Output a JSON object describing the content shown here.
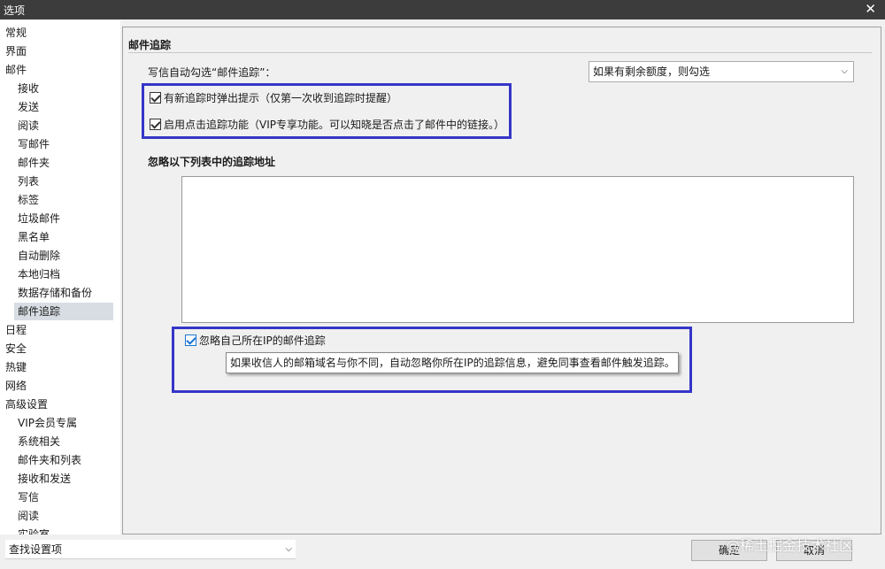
{
  "window": {
    "title": "选项",
    "close_symbol": "✕"
  },
  "sidebar": {
    "items": [
      {
        "label": "常规",
        "level": 0
      },
      {
        "label": "界面",
        "level": 0
      },
      {
        "label": "邮件",
        "level": 0
      },
      {
        "label": "接收",
        "level": 1
      },
      {
        "label": "发送",
        "level": 1
      },
      {
        "label": "阅读",
        "level": 1
      },
      {
        "label": "写邮件",
        "level": 1
      },
      {
        "label": "邮件夹",
        "level": 1
      },
      {
        "label": "列表",
        "level": 1
      },
      {
        "label": "标签",
        "level": 1
      },
      {
        "label": "垃圾邮件",
        "level": 1
      },
      {
        "label": "黑名单",
        "level": 1
      },
      {
        "label": "自动删除",
        "level": 1
      },
      {
        "label": "本地归档",
        "level": 1
      },
      {
        "label": "数据存储和备份",
        "level": 1
      },
      {
        "label": "邮件追踪",
        "level": 1,
        "selected": true
      },
      {
        "label": "日程",
        "level": 0
      },
      {
        "label": "安全",
        "level": 0
      },
      {
        "label": "热键",
        "level": 0
      },
      {
        "label": "网络",
        "level": 0
      },
      {
        "label": "高级设置",
        "level": 0
      },
      {
        "label": "VIP会员专属",
        "level": 1
      },
      {
        "label": "系统相关",
        "level": 1
      },
      {
        "label": "邮件夹和列表",
        "level": 1
      },
      {
        "label": "接收和发送",
        "level": 1
      },
      {
        "label": "写信",
        "level": 1
      },
      {
        "label": "阅读",
        "level": 1
      },
      {
        "label": "实验室",
        "level": 1
      }
    ]
  },
  "main": {
    "section_title": "邮件追踪",
    "auto_check_label": "写信自动勾选“邮件追踪”：",
    "auto_check_dropdown": {
      "value": "如果有剩余额度，则勾选",
      "chevron": "⌵"
    },
    "options": [
      {
        "label": "有新追踪时弹出提示（仅第一次收到追踪时提醒）",
        "checked": true
      },
      {
        "label": "启用点击追踪功能（VIP专享功能。可以知晓是否点击了邮件中的链接。）",
        "checked": true
      }
    ],
    "ignore_list_title": "忽略以下列表中的追踪地址",
    "ignore_own_ip": {
      "label": "忽略自己所在IP的邮件追踪",
      "checked": true
    },
    "tooltip": "如果收信人的邮箱域名与你不同，自动忽略你所在IP的追踪信息，避免同事查看邮件触发追踪。"
  },
  "footer": {
    "search_placeholder": "查找设置项",
    "search_chevron": "⌵",
    "ok_label": "确定",
    "cancel_label": "取消",
    "watermark": "@稀土掘金技术社区"
  },
  "colors": {
    "highlight_border": "#3535c8",
    "selected_bg": "#d8dde3",
    "checkbox_accent": "#1976d2"
  }
}
